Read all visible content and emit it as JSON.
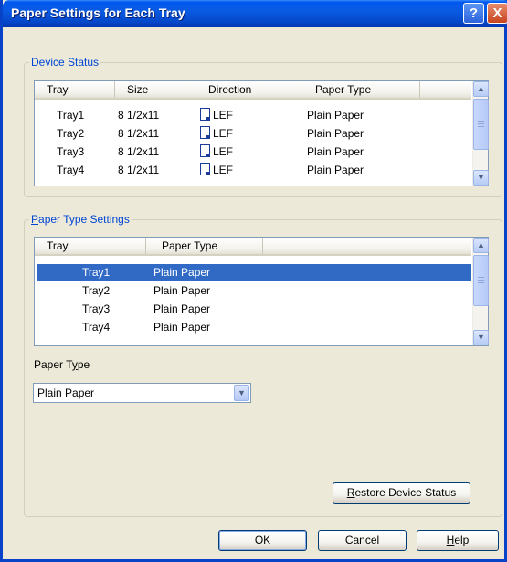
{
  "window": {
    "title": "Paper Settings for Each Tray",
    "help_glyph": "?",
    "close_glyph": "X"
  },
  "device_status": {
    "legend": "Device Status",
    "columns": [
      "Tray",
      "Size",
      "Direction",
      "Paper Type"
    ],
    "rows": [
      {
        "tray": "Tray1",
        "size": "8 1/2x11",
        "direction": "LEF",
        "paper_type": "Plain Paper"
      },
      {
        "tray": "Tray2",
        "size": "8 1/2x11",
        "direction": "LEF",
        "paper_type": "Plain Paper"
      },
      {
        "tray": "Tray3",
        "size": "8 1/2x11",
        "direction": "LEF",
        "paper_type": "Plain Paper"
      },
      {
        "tray": "Tray4",
        "size": "8 1/2x11",
        "direction": "LEF",
        "paper_type": "Plain Paper"
      }
    ],
    "direction_icon": "document-orientation-icon"
  },
  "paper_type_settings": {
    "legend_accel": "P",
    "legend_rest": "aper Type Settings",
    "columns": [
      "Tray",
      "Paper Type"
    ],
    "rows": [
      {
        "tray": "Tray1",
        "paper_type": "Plain Paper",
        "selected": true
      },
      {
        "tray": "Tray2",
        "paper_type": "Plain Paper",
        "selected": false
      },
      {
        "tray": "Tray3",
        "paper_type": "Plain Paper",
        "selected": false
      },
      {
        "tray": "Tray4",
        "paper_type": "Plain Paper",
        "selected": false
      }
    ],
    "paper_type_label_pre": "Paper T",
    "paper_type_label_accel": "y",
    "paper_type_label_post": "pe",
    "paper_type_value": "Plain Paper",
    "restore_accel": "R",
    "restore_rest": "estore Device Status"
  },
  "footer": {
    "ok_label": "OK",
    "cancel_label": "Cancel",
    "help_accel": "H",
    "help_rest": "elp"
  },
  "colors": {
    "titlebar": "#0A5BE3",
    "selection": "#316AC5",
    "legend_text": "#0046D5"
  }
}
